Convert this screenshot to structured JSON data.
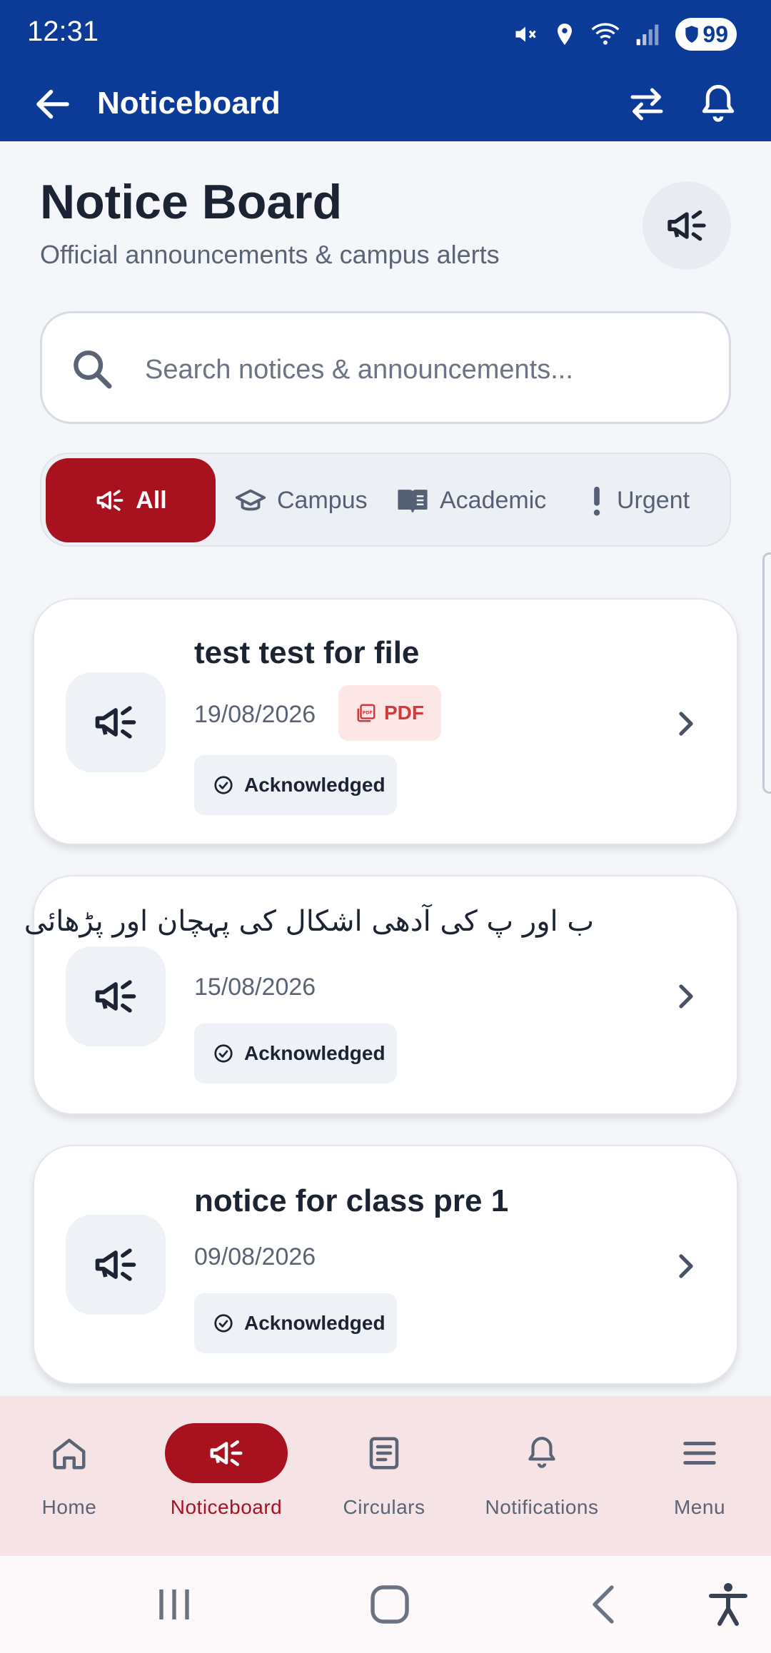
{
  "status_bar": {
    "time": "12:31",
    "battery": "99"
  },
  "app_bar": {
    "title": "Noticeboard"
  },
  "header": {
    "title": "Notice Board",
    "subtitle": "Official announcements & campus alerts"
  },
  "search": {
    "placeholder": "Search notices & announcements...",
    "value": ""
  },
  "filters": [
    {
      "label": "All",
      "icon": "megaphone-icon",
      "active": true
    },
    {
      "label": "Campus",
      "icon": "graduation-cap-icon",
      "active": false
    },
    {
      "label": "Academic",
      "icon": "book-icon",
      "active": false
    },
    {
      "label": "Urgent",
      "icon": "exclamation-icon",
      "active": false
    }
  ],
  "notices": [
    {
      "title": "test test for file",
      "date": "19/08/2026",
      "attachment": "PDF",
      "status": "Acknowledged"
    },
    {
      "title": "ب اور پ کی آدھی اشکال کی پہچان اور پڑھائی",
      "date": "15/08/2026",
      "attachment": "",
      "status": "Acknowledged"
    },
    {
      "title": "notice for class pre 1",
      "date": "09/08/2026",
      "attachment": "",
      "status": "Acknowledged"
    }
  ],
  "bottom_nav": [
    {
      "label": "Home",
      "icon": "home-icon",
      "active": false
    },
    {
      "label": "Noticeboard",
      "icon": "megaphone-icon",
      "active": true
    },
    {
      "label": "Circulars",
      "icon": "document-icon",
      "active": false
    },
    {
      "label": "Notifications",
      "icon": "bell-icon",
      "active": false
    },
    {
      "label": "Menu",
      "icon": "menu-icon",
      "active": false
    }
  ],
  "colors": {
    "primary": "#0b3a97",
    "accent": "#a8121f",
    "background": "#f4f6f9",
    "pdf_badge": "#d23a3a",
    "bottom_nav_bg": "#f5e3e6"
  }
}
